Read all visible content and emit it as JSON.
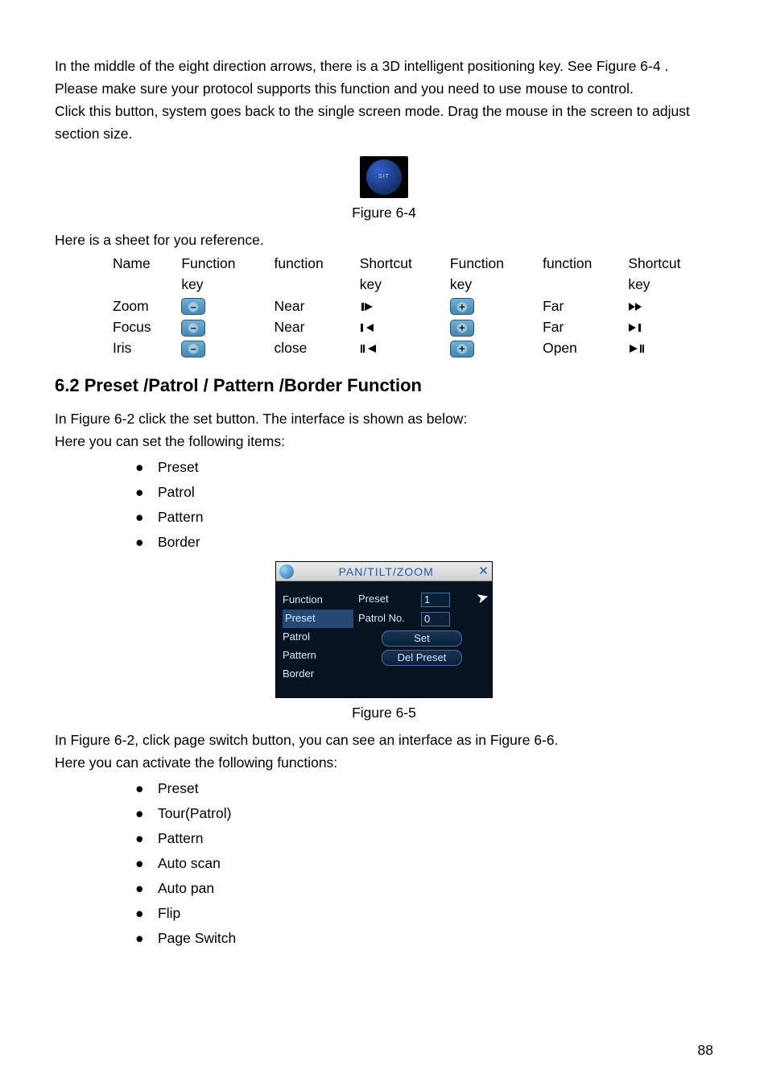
{
  "intro": {
    "p1": "In the middle of the eight direction arrows, there is a 3D intelligent positioning key. See Figure 6-4 . Please make sure your protocol supports this function and you need to use mouse to control.",
    "p2": "Click this button, system goes back to the single screen mode. Drag the mouse in the screen to adjust section size."
  },
  "sit_label": "SIT",
  "fig64": "Figure 6-4",
  "sheet_ref": "Here is a sheet for you reference.",
  "table": {
    "headers": [
      "Name",
      "Function\nkey",
      "function",
      "Shortcut\nkey",
      "Function\nkey",
      "function",
      "Shortcut\nkey"
    ],
    "rows": [
      {
        "name": "Zoom",
        "fn1": "Near",
        "sc1": "zoom-near-icon",
        "fn2": "Far",
        "sc2": "zoom-far-icon"
      },
      {
        "name": "Focus",
        "fn1": "Near",
        "sc1": "focus-near-icon",
        "fn2": "Far",
        "sc2": "focus-far-icon"
      },
      {
        "name": "Iris",
        "fn1": "close",
        "sc1": "iris-close-icon",
        "fn2": "Open",
        "sc2": "iris-open-icon"
      }
    ]
  },
  "section62": {
    "title": "6.2  Preset  /Patrol / Pattern /Border  Function",
    "p1": "In Figure 6-2 click the set button. The interface is shown as below:",
    "p2": "Here you can set the following items:",
    "list1": [
      "Preset",
      "Patrol",
      "Pattern",
      "Border"
    ],
    "ptz": {
      "window_title": "PAN/TILT/ZOOM",
      "left_label": "Function",
      "left_items": [
        "Preset",
        "Patrol",
        "Pattern",
        "Border"
      ],
      "selected_index": 0,
      "preset_label": "Preset",
      "preset_value": "1",
      "patrol_label": "Patrol No.",
      "patrol_value": "0",
      "btn_set": "Set",
      "btn_del": "Del Preset"
    },
    "fig65": "Figure 6-5",
    "p3": "In Figure 6-2, click page switch button, you can see an interface as in Figure 6-6.",
    "p4": "Here you can activate the following functions:",
    "list2": [
      "Preset",
      "Tour(Patrol)",
      "Pattern",
      "Auto scan",
      "Auto pan",
      "Flip",
      "Page Switch"
    ]
  },
  "page_no": "88"
}
